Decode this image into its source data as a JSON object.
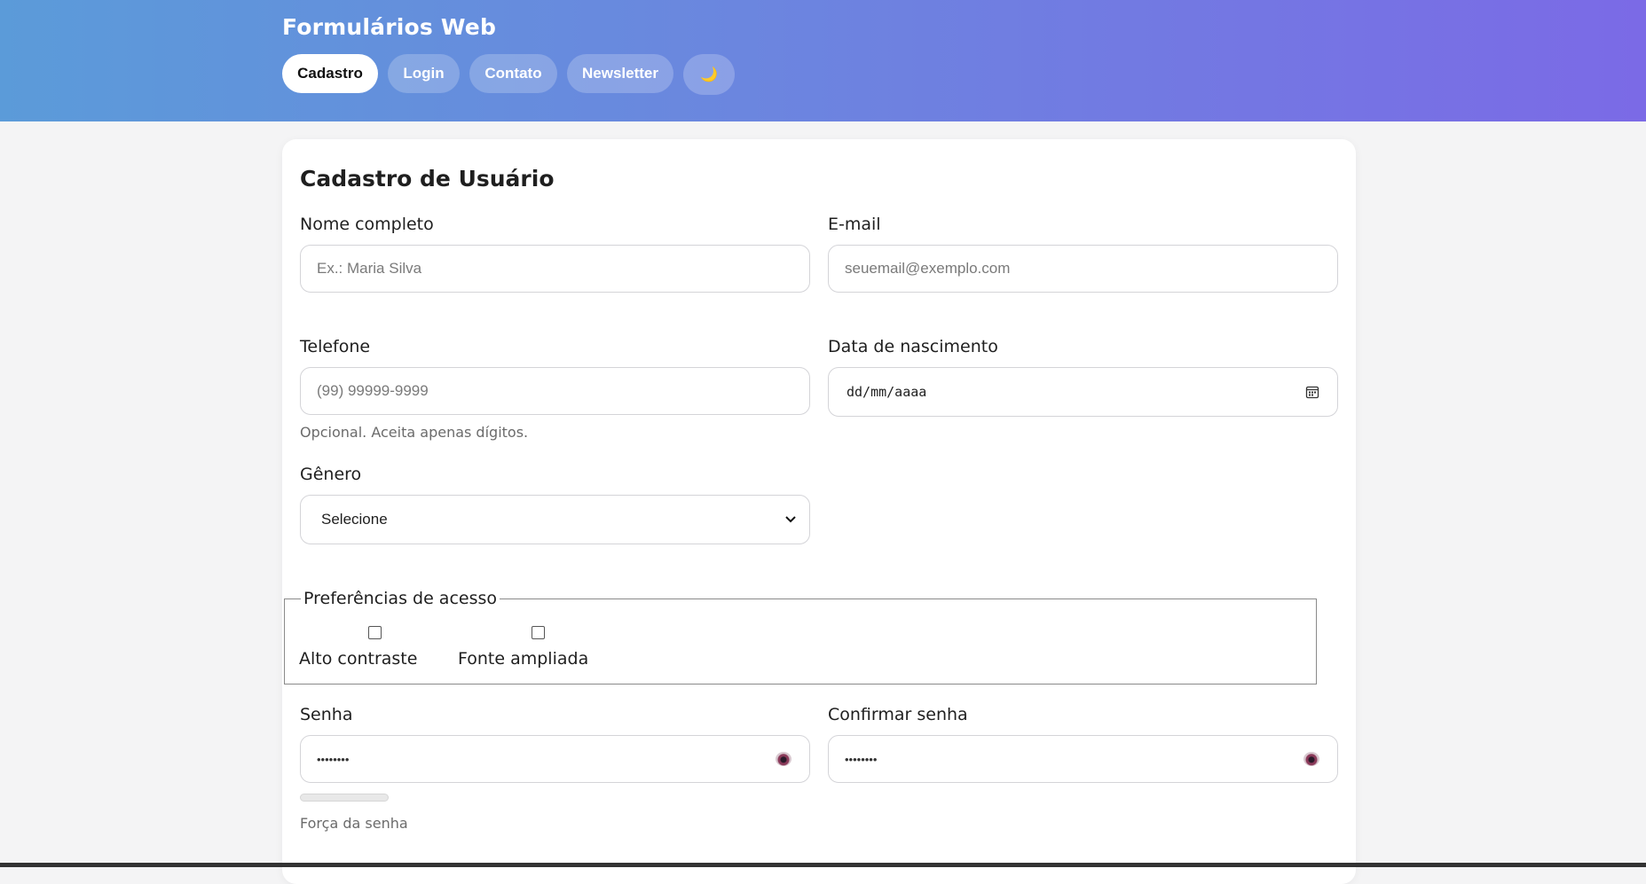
{
  "header": {
    "app_title": "Formulários Web",
    "nav": [
      {
        "label": "Cadastro",
        "active": true
      },
      {
        "label": "Login",
        "active": false
      },
      {
        "label": "Contato",
        "active": false
      },
      {
        "label": "Newsletter",
        "active": false
      }
    ],
    "theme_toggle_icon": "🌙"
  },
  "form": {
    "title": "Cadastro de Usuário",
    "name": {
      "label": "Nome completo",
      "placeholder": "Ex.: Maria Silva",
      "value": ""
    },
    "email": {
      "label": "E-mail",
      "placeholder": "seuemail@exemplo.com",
      "value": ""
    },
    "phone": {
      "label": "Telefone",
      "placeholder": "(99) 99999-9999",
      "value": "",
      "hint": "Opcional. Aceita apenas dígitos."
    },
    "birthdate": {
      "label": "Data de nascimento",
      "value": "dd/mm/aaaa",
      "icon": "calendar-icon"
    },
    "gender": {
      "label": "Gênero",
      "selected": "Selecione",
      "icon": "chevron-down-icon"
    },
    "access_prefs": {
      "legend": "Preferências de acesso",
      "options": [
        {
          "label": "Alto contraste",
          "checked": false
        },
        {
          "label": "Fonte ampliada",
          "checked": false
        }
      ]
    },
    "password": {
      "label": "Senha",
      "value": "••••••••",
      "icon": "eye-icon"
    },
    "confirm_password": {
      "label": "Confirmar senha",
      "value": "••••••••",
      "icon": "eye-icon"
    },
    "strength": {
      "label": "Força da senha",
      "level": 0
    }
  },
  "colors": {
    "header_gradient_start": "#5b9bd9",
    "header_gradient_end": "#7b6ae6",
    "card_bg": "#ffffff",
    "page_bg": "#f4f4f5"
  }
}
